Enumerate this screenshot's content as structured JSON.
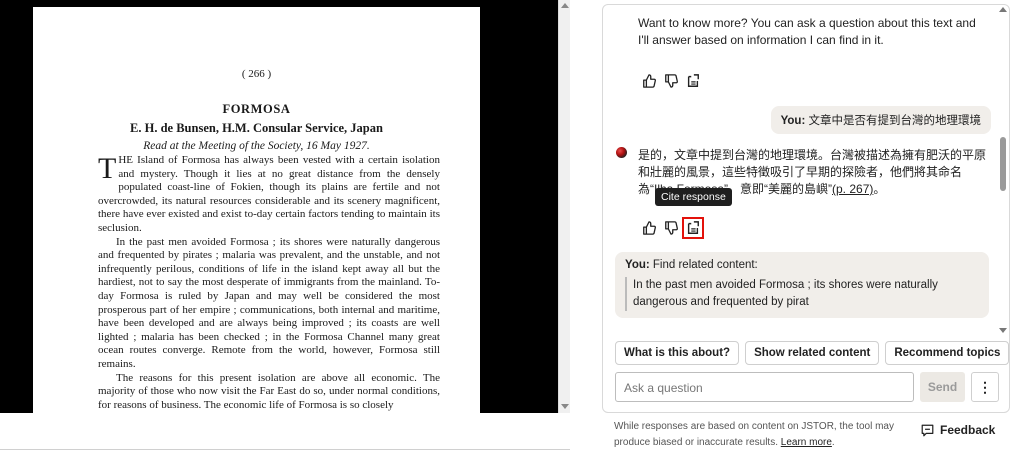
{
  "document": {
    "page_number": "( 266 )",
    "title": "FORMOSA",
    "author": "E. H. de Bunsen, H.M. Consular Service, Japan",
    "meeting": "Read at the Meeting of the Society, 16 May 1927.",
    "drop_cap": "T",
    "para1": "HE Island of Formosa has always been vested with a certain isolation and mystery. Though it lies at no great distance from the densely populated coast-line of Fokien, though its plains are fertile and not overcrowded, its natural resources considerable and its scenery magnificent, there have ever existed and exist to-day certain factors tending to maintain its seclusion.",
    "para2": "In the past men avoided Formosa ; its shores were naturally dangerous and frequented by pirates ; malaria was prevalent, and the unstable, and not infrequently perilous, conditions of life in the island kept away all but the hardiest, not to say the most desperate of immigrants from the mainland. To-day Formosa is ruled by Japan and may well be considered the most prosperous part of her empire ; communications, both internal and maritime, have been developed and are always being improved ; its coasts are well lighted ; malaria has been checked ; in the Formosa Channel many great ocean routes converge. Remote from the world, however, Formosa still remains.",
    "para3": "The reasons for this present isolation are above all economic. The majority of those who now visit the Far East do so, under normal conditions, for reasons of business. The economic life of Formosa is so closely"
  },
  "chat": {
    "intro": "Want to know more? You can ask a question about this text and I'll answer based on information I can find in it.",
    "user_msg_1": {
      "label": "You:",
      "text": "文章中是否有提到台灣的地理環境"
    },
    "bot_answer": {
      "text": "是的，文章中提到台灣的地理環境。台灣被描述為擁有肥沃的平原和壯麗的風景，這些特徵吸引了早期的探險者，他們將其命名為“Ilha Formosa”，意即“美麗的島嶼”",
      "cite": "(p. 267)",
      "end": "。"
    },
    "tooltip": "Cite response",
    "user_msg_2": {
      "label": "You:",
      "text": "Find related content:",
      "quote": "In the past men avoided Formosa ; its shores were naturally dangerous and frequented by pirat"
    },
    "feedback_icons": [
      "thumbs-up-icon",
      "thumbs-down-icon",
      "cite-icon"
    ]
  },
  "suggestions": [
    "What is this about?",
    "Show related content",
    "Recommend topics"
  ],
  "input": {
    "placeholder": "Ask a question",
    "value": "",
    "send_label": "Send",
    "more_label": "⋮"
  },
  "footer": {
    "disclaimer": "While responses are based on content on JSTOR, the tool may produce biased or inaccurate results.",
    "learn_more": "Learn more",
    "learn_more_end": ".",
    "feedback_label": "Feedback"
  },
  "colors": {
    "highlight_outline": "#e3120b",
    "bubble_bg": "#f1eeea",
    "viewer_bg": "#000000"
  }
}
